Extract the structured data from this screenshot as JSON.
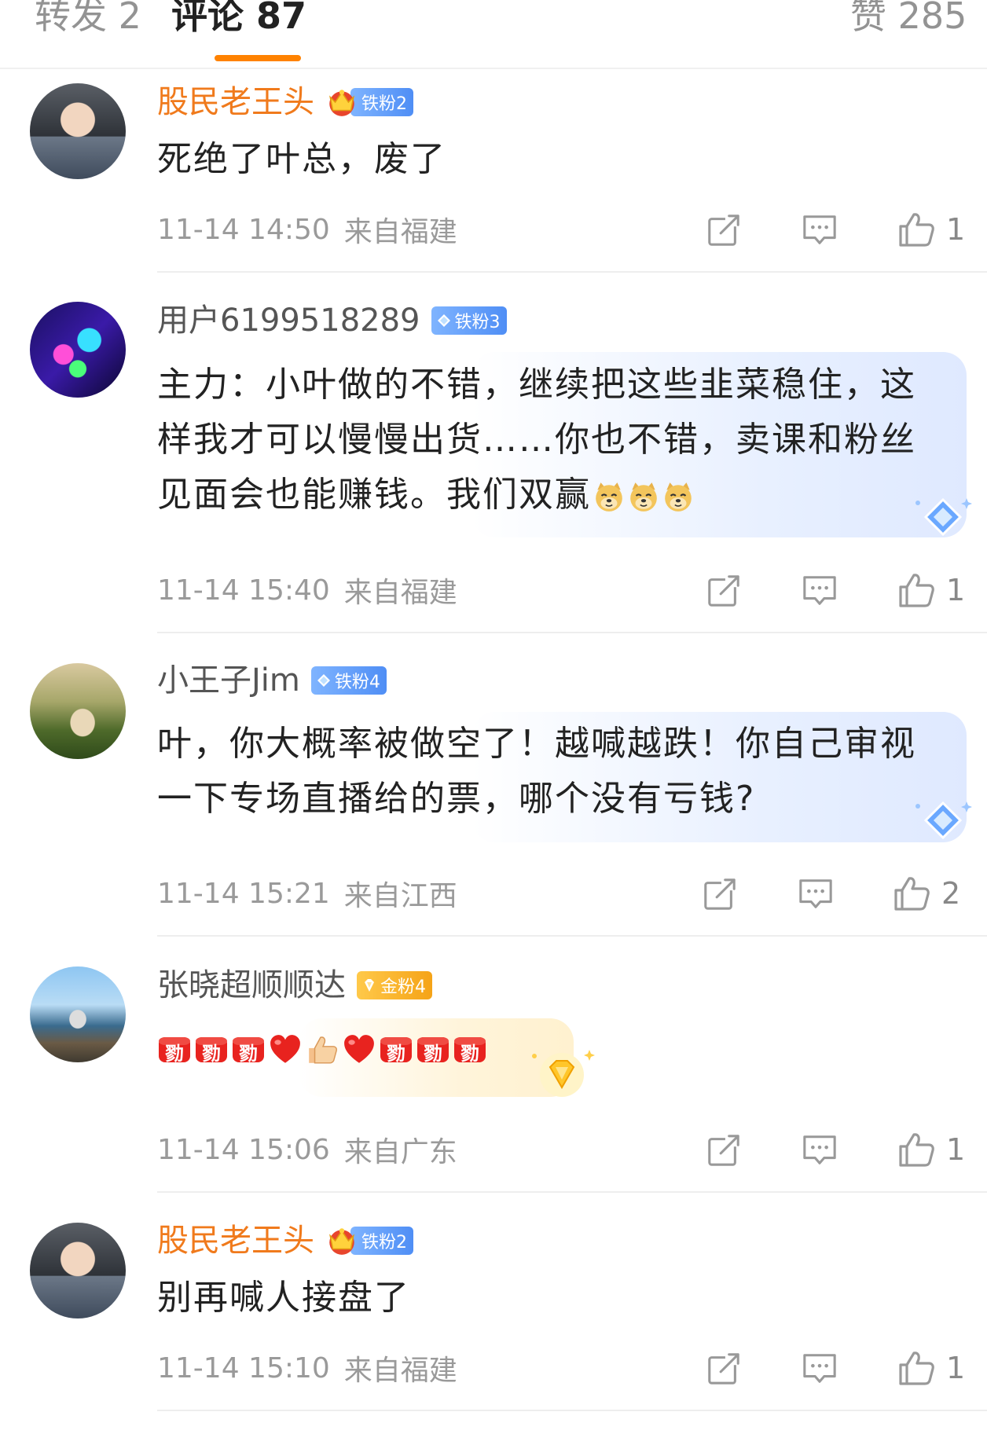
{
  "tabs": [
    {
      "label": "转发 2"
    },
    {
      "label": "评论 87"
    },
    {
      "label": "赞 285"
    }
  ],
  "comments": [
    {
      "username": "股民老王头",
      "badge": "铁粉2",
      "text": "死绝了叶总，废了",
      "time": "11-14 14:50",
      "location": "来自福建",
      "likes": "1"
    },
    {
      "username": "用户6199518289",
      "badge": "铁粉3",
      "text": "主力：小叶做的不错，继续把这些韭菜稳住，这样我才可以慢慢出货……你也不错，卖课和粉丝见面会也能赚钱。我们双赢",
      "time": "11-14 15:40",
      "location": "来自福建",
      "likes": "1"
    },
    {
      "username": "小王子Jim",
      "badge": "铁粉4",
      "text": "叶，你大概率被做空了！越喊越跌！你自己审视一下专场直播给的票，哪个没有亏钱?",
      "time": "11-14 15:21",
      "location": "来自江西",
      "likes": "2"
    },
    {
      "username": "张晓超顺顺达",
      "badge": "金粉4",
      "text": "",
      "time": "11-14 15:06",
      "location": "来自广东",
      "likes": "1"
    },
    {
      "username": "股民老王头",
      "badge": "铁粉2",
      "text": "别再喊人接盘了",
      "time": "11-14 15:10",
      "location": "来自福建",
      "likes": "1"
    }
  ],
  "emoji_sticker_label": "勠",
  "icons": [
    "share-icon",
    "reply-icon",
    "like-icon",
    "diamond-icon",
    "crown-icon",
    "doge-emoji",
    "heart-emoji",
    "thumbs-up-emoji"
  ],
  "colors": {
    "accent": "#ff8200",
    "vip_name": "#f07a1c",
    "iron_badge": "#4f8ef5",
    "gold_badge": "#f5a317"
  }
}
